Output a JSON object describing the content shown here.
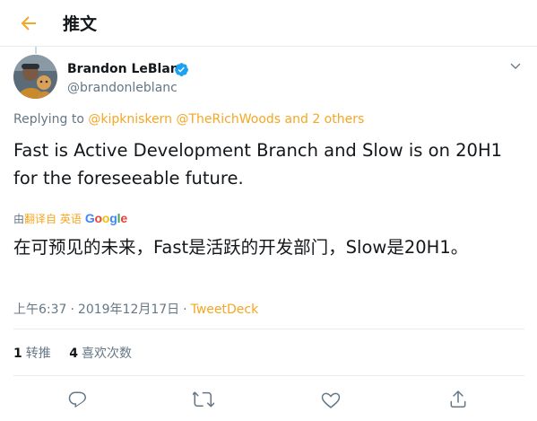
{
  "header": {
    "title": "推文",
    "back_icon": "arrow-left-icon"
  },
  "colors": {
    "accent": "#f5a623",
    "text": "#14171a",
    "secondary": "#657786",
    "verified": "#1da1f2",
    "divider": "#e6ecf0"
  },
  "author": {
    "name": "Brandon LeBlanc",
    "handle": "@brandonleblanc",
    "verified_icon": "verified-badge-icon",
    "more_icon": "chevron-down-icon"
  },
  "reply": {
    "prefix": "Replying to",
    "mention1": "@kipkniskern",
    "mention2": "@TheRichWoods",
    "conjunction": "and",
    "others": "2 others"
  },
  "tweet": {
    "text": "Fast is Active Development Branch and Slow is on 20H1 for the foreseeable future."
  },
  "translation": {
    "prefix": "由",
    "link": "翻译自 英语",
    "provider": "Google",
    "text": "在可预见的未来，Fast是活跃的开发部门，Slow是20H1。"
  },
  "meta": {
    "time": "上午6:37",
    "separator": "·",
    "date": "2019年12月17日",
    "separator2": "·",
    "source": "TweetDeck"
  },
  "stats": {
    "retweets_count": "1",
    "retweets_label": "转推",
    "likes_count": "4",
    "likes_label": "喜欢次数"
  },
  "actions": {
    "reply_icon": "reply-icon",
    "retweet_icon": "retweet-icon",
    "like_icon": "heart-icon",
    "share_icon": "share-icon"
  }
}
